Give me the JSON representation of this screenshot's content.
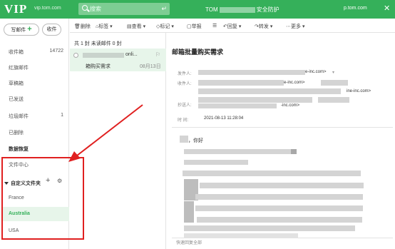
{
  "header": {
    "logo": "VIP",
    "logo_sub": "vip.tom.com",
    "search_placeholder": "搜索",
    "center_left": "TOM",
    "center_right": "安全防护",
    "right_domain": "p.tom.com",
    "accent_color": "#35b05a"
  },
  "sidebar": {
    "write_label": "写邮件",
    "receive_label": "收件",
    "folders": [
      {
        "label": "收件箱",
        "count": "14722"
      },
      {
        "label": "红旗邮件",
        "count": ""
      },
      {
        "label": "草稿箱",
        "count": ""
      },
      {
        "label": "已发送",
        "count": ""
      },
      {
        "label": "垃圾邮件",
        "count": "1"
      },
      {
        "label": "已删除",
        "count": ""
      },
      {
        "label": "数据恢复",
        "count": ""
      },
      {
        "label": "文件中心",
        "count": ""
      }
    ],
    "custom_title": "自定义文件夹",
    "custom_folders": [
      "France",
      "Australia",
      "USA"
    ]
  },
  "toolbar": {
    "items": [
      "删除",
      "标签 ▾",
      "查看 ▾",
      "标记 ▾",
      "举报",
      "回复 ▾",
      "转发 ▾",
      "更多 ▾"
    ]
  },
  "list": {
    "header": "共 1 封  未读邮件 0 封",
    "item": {
      "sender": "onli...",
      "subject": "箱购买需求",
      "date": "08月13日"
    }
  },
  "reader": {
    "subject": "邮箱批量购买需求",
    "labels": {
      "from": "发件人:",
      "to": "收件人:",
      "cc": "抄送人:",
      "time": "时   间:"
    },
    "from_suffix": "e-inc.com>",
    "to_suffix_1": "e-inc.com>",
    "to_suffix_2": "ine-inc.com>",
    "to_suffix_3": "ine-inc.com>",
    "cc_suffix": "-inc.com>",
    "time_value": "2021-08-13 11:28:04",
    "greeting": "，你好",
    "quick_reply": "快速回复全部"
  }
}
